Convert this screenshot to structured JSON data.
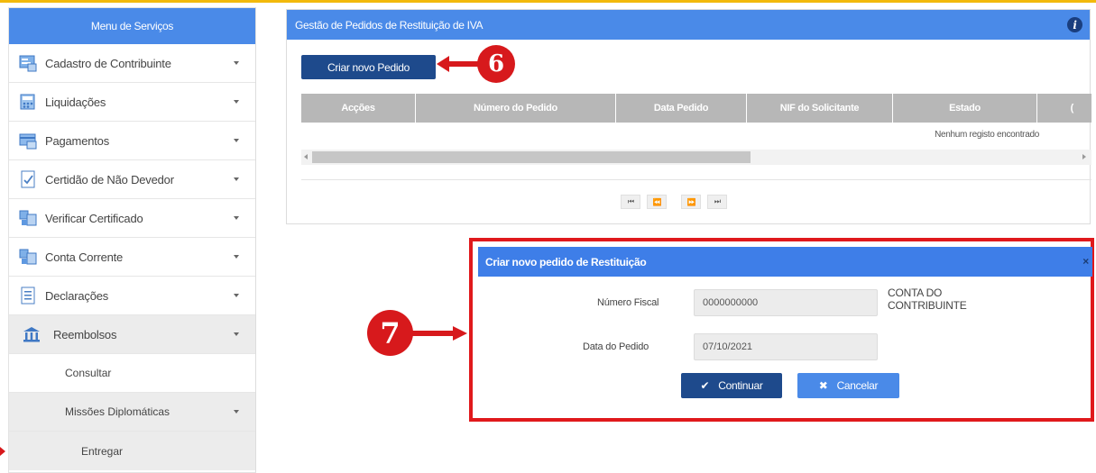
{
  "colors": {
    "header_blue": "#4a8ae8",
    "dark_blue": "#1e4a8c",
    "annotation_red": "#d7191c",
    "accent_yellow": "#f2b90c"
  },
  "sidebar": {
    "title": "Menu de Serviços",
    "items": [
      {
        "label": "Cadastro de Contribuinte",
        "icon": "document-form-icon"
      },
      {
        "label": "Liquidações",
        "icon": "calculator-icon"
      },
      {
        "label": "Pagamentos",
        "icon": "payment-icon"
      },
      {
        "label": "Certidão de Não Devedor",
        "icon": "certificate-icon"
      },
      {
        "label": "Verificar Certificado",
        "icon": "verify-icon"
      },
      {
        "label": "Conta Corrente",
        "icon": "account-icon"
      },
      {
        "label": "Declarações",
        "icon": "declaration-icon"
      },
      {
        "label": "Reembolsos",
        "icon": "bank-icon"
      }
    ],
    "submenu": {
      "consultar": "Consultar",
      "missoes": "Missões Diplomáticas",
      "entregar": "Entregar"
    }
  },
  "panel": {
    "title": "Gestão de Pedidos de Restituição de IVA",
    "info_icon": "i",
    "new_button": "Criar novo Pedido",
    "table": {
      "headers": [
        "Acções",
        "Número do Pedido",
        "Data Pedido",
        "NIF do Solicitante",
        "Estado",
        "("
      ],
      "empty_message": "Nenhum registo encontrado"
    },
    "pager": [
      "⏮",
      "⏪",
      "⏩",
      "⏭"
    ]
  },
  "annotations": {
    "six": "6",
    "seven": "7"
  },
  "modal": {
    "title": "Criar novo pedido de Restituição",
    "close": "×",
    "nif_label": "Número Fiscal",
    "nif_value": "0000000000",
    "date_label": "Data do Pedido",
    "date_value": "07/10/2021",
    "account_text": "CONTA DO CONTRIBUINTE",
    "continue_label": "Continuar",
    "continue_icon": "✔",
    "cancel_label": "Cancelar",
    "cancel_icon": "✖"
  }
}
